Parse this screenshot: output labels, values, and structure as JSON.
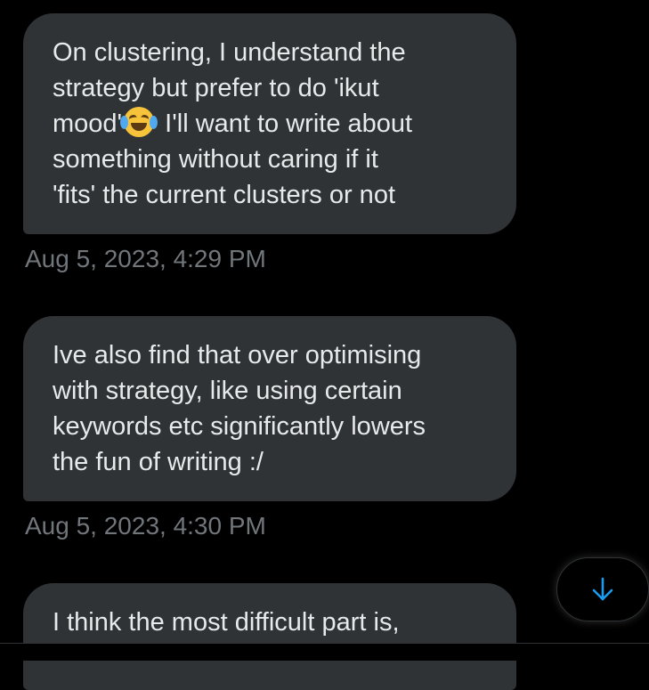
{
  "messages": [
    {
      "lines": [
        "On clustering, I understand the",
        "strategy but prefer to do 'ikut",
        "mood'",
        " I'll want to write about",
        "something without caring if it",
        "'fits' the current clusters or not"
      ],
      "emoji": "face-with-tears-of-joy",
      "timestamp": "Aug 5, 2023, 4:29 PM"
    },
    {
      "lines": [
        "Ive also find that over optimising",
        "with strategy, like using certain",
        "keywords etc significantly lowers",
        "the fun of writing :/"
      ],
      "timestamp": "Aug 5, 2023, 4:30 PM"
    },
    {
      "lines": [
        "I think the most difficult part is,"
      ]
    }
  ],
  "scroll_button": {
    "icon": "arrow-down-icon"
  },
  "colors": {
    "background": "#000000",
    "bubble": "#2f3336",
    "text": "#e7e9ea",
    "timestamp": "#71767b",
    "accent": "#1d9bf0"
  }
}
